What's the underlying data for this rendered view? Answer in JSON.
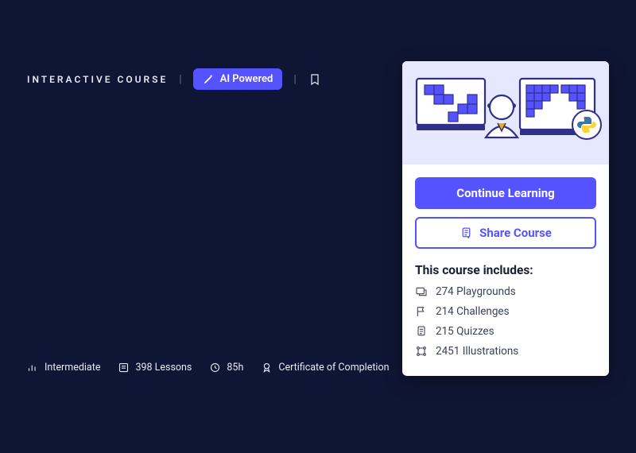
{
  "header": {
    "course_type": "INTERACTIVE COURSE",
    "ai_badge": "AI Powered"
  },
  "meta": {
    "level": "Intermediate",
    "lessons": "398 Lessons",
    "duration": "85h",
    "certificate": "Certificate of Completion"
  },
  "card": {
    "primary_button": "Continue Learning",
    "share_button": "Share Course",
    "includes_title": "This course includes:",
    "items": [
      {
        "label": "274 Playgrounds"
      },
      {
        "label": "214 Challenges"
      },
      {
        "label": "215 Quizzes"
      },
      {
        "label": "2451 Illustrations"
      }
    ]
  }
}
